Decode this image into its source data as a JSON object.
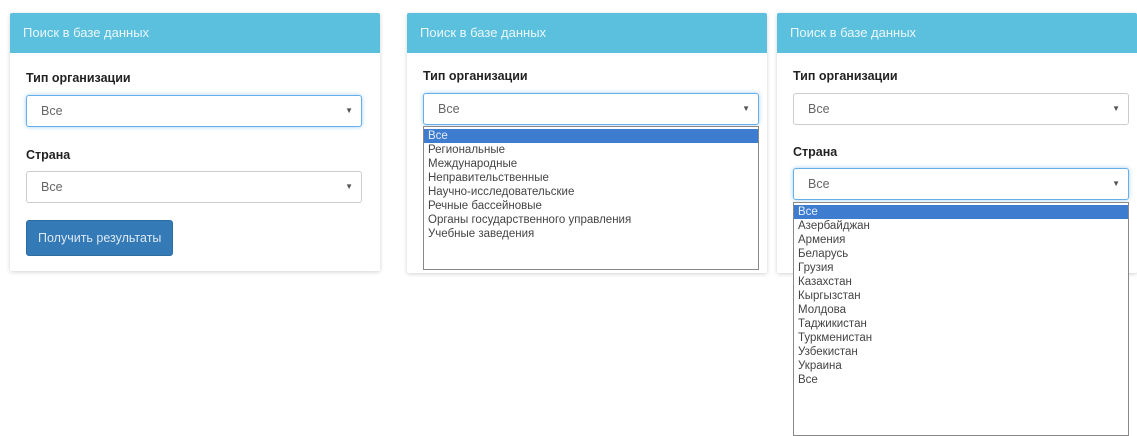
{
  "panel1": {
    "header": "Поиск в базе данных",
    "org_label": "Тип организации",
    "org_value": "Все",
    "country_label": "Страна",
    "country_value": "Все",
    "submit": "Получить результаты"
  },
  "panel2": {
    "header": "Поиск в базе данных",
    "org_label": "Тип организации",
    "org_value": "Все",
    "options": [
      "Все",
      "Региональные",
      "Международные",
      "Неправительственные",
      "Научно-исследовательские",
      "Речные бассейновые",
      "Органы государственного управления",
      "Учебные заведения"
    ]
  },
  "panel3": {
    "header": "Поиск в базе данных",
    "org_label": "Тип организации",
    "org_value": "Все",
    "country_label": "Страна",
    "country_value": "Все",
    "options": [
      "Все",
      "Азербайджан",
      "Армения",
      "Беларусь",
      "Грузия",
      "Казахстан",
      "Кыргызстан",
      "Молдова",
      "Таджикистан",
      "Туркменистан",
      "Узбекистан",
      "Украина",
      "Все"
    ]
  },
  "colors": {
    "header": "#5bc0de",
    "button": "#337ab7",
    "selected_option": "#3d7ccf"
  },
  "icons": {
    "caret": "caret-down-icon"
  }
}
